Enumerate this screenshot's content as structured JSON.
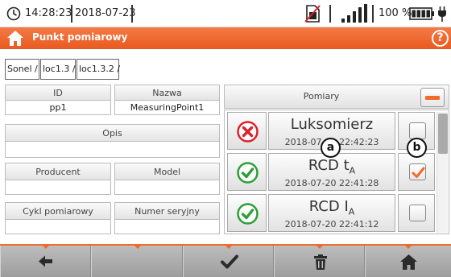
{
  "status_bar": {
    "time": "14:28:23",
    "date": "2018-07-23",
    "battery_percent": "100 %",
    "icons": [
      "clock-icon",
      "no-sim-icon",
      "signal-icon",
      "battery-icon",
      "plug-icon"
    ]
  },
  "title_bar": {
    "title": "Punkt pomiarowy",
    "help_label": "?",
    "color": "#e95a20"
  },
  "breadcrumb": [
    "Sonel /",
    "loc1.3 /",
    "loc1.3.2 /"
  ],
  "fields": {
    "id": {
      "label": "ID",
      "value": "pp1"
    },
    "nazwa": {
      "label": "Nazwa",
      "value": "MeasuringPoint1"
    },
    "opis": {
      "label": "Opis",
      "value": ""
    },
    "producent": {
      "label": "Producent",
      "value": ""
    },
    "model": {
      "label": "Model",
      "value": ""
    },
    "cykl": {
      "label": "Cykl pomiarowy",
      "value": ""
    },
    "numer": {
      "label": "Numer seryjny",
      "value": ""
    }
  },
  "measurements": {
    "header": "Pomiary",
    "rows": [
      {
        "name": "Luksomierz",
        "sub": "",
        "datetime": "2018-07-20 22:42:23",
        "status": "fail",
        "checked": false
      },
      {
        "name": "RCD t",
        "sub": "A",
        "datetime": "2018-07-20 22:41:28",
        "status": "pass",
        "checked": true
      },
      {
        "name": "RCD I",
        "sub": "A",
        "datetime": "2018-07-20 22:41:12",
        "status": "pass",
        "checked": false
      }
    ]
  },
  "callouts": {
    "a": "a",
    "b": "b"
  },
  "toolbar": [
    "back-arrow-icon",
    "",
    "check-icon",
    "trash-icon",
    "home-icon"
  ],
  "colors": {
    "accent": "#f06b2a",
    "fail": "#d9232a",
    "pass": "#2e9e3a"
  }
}
